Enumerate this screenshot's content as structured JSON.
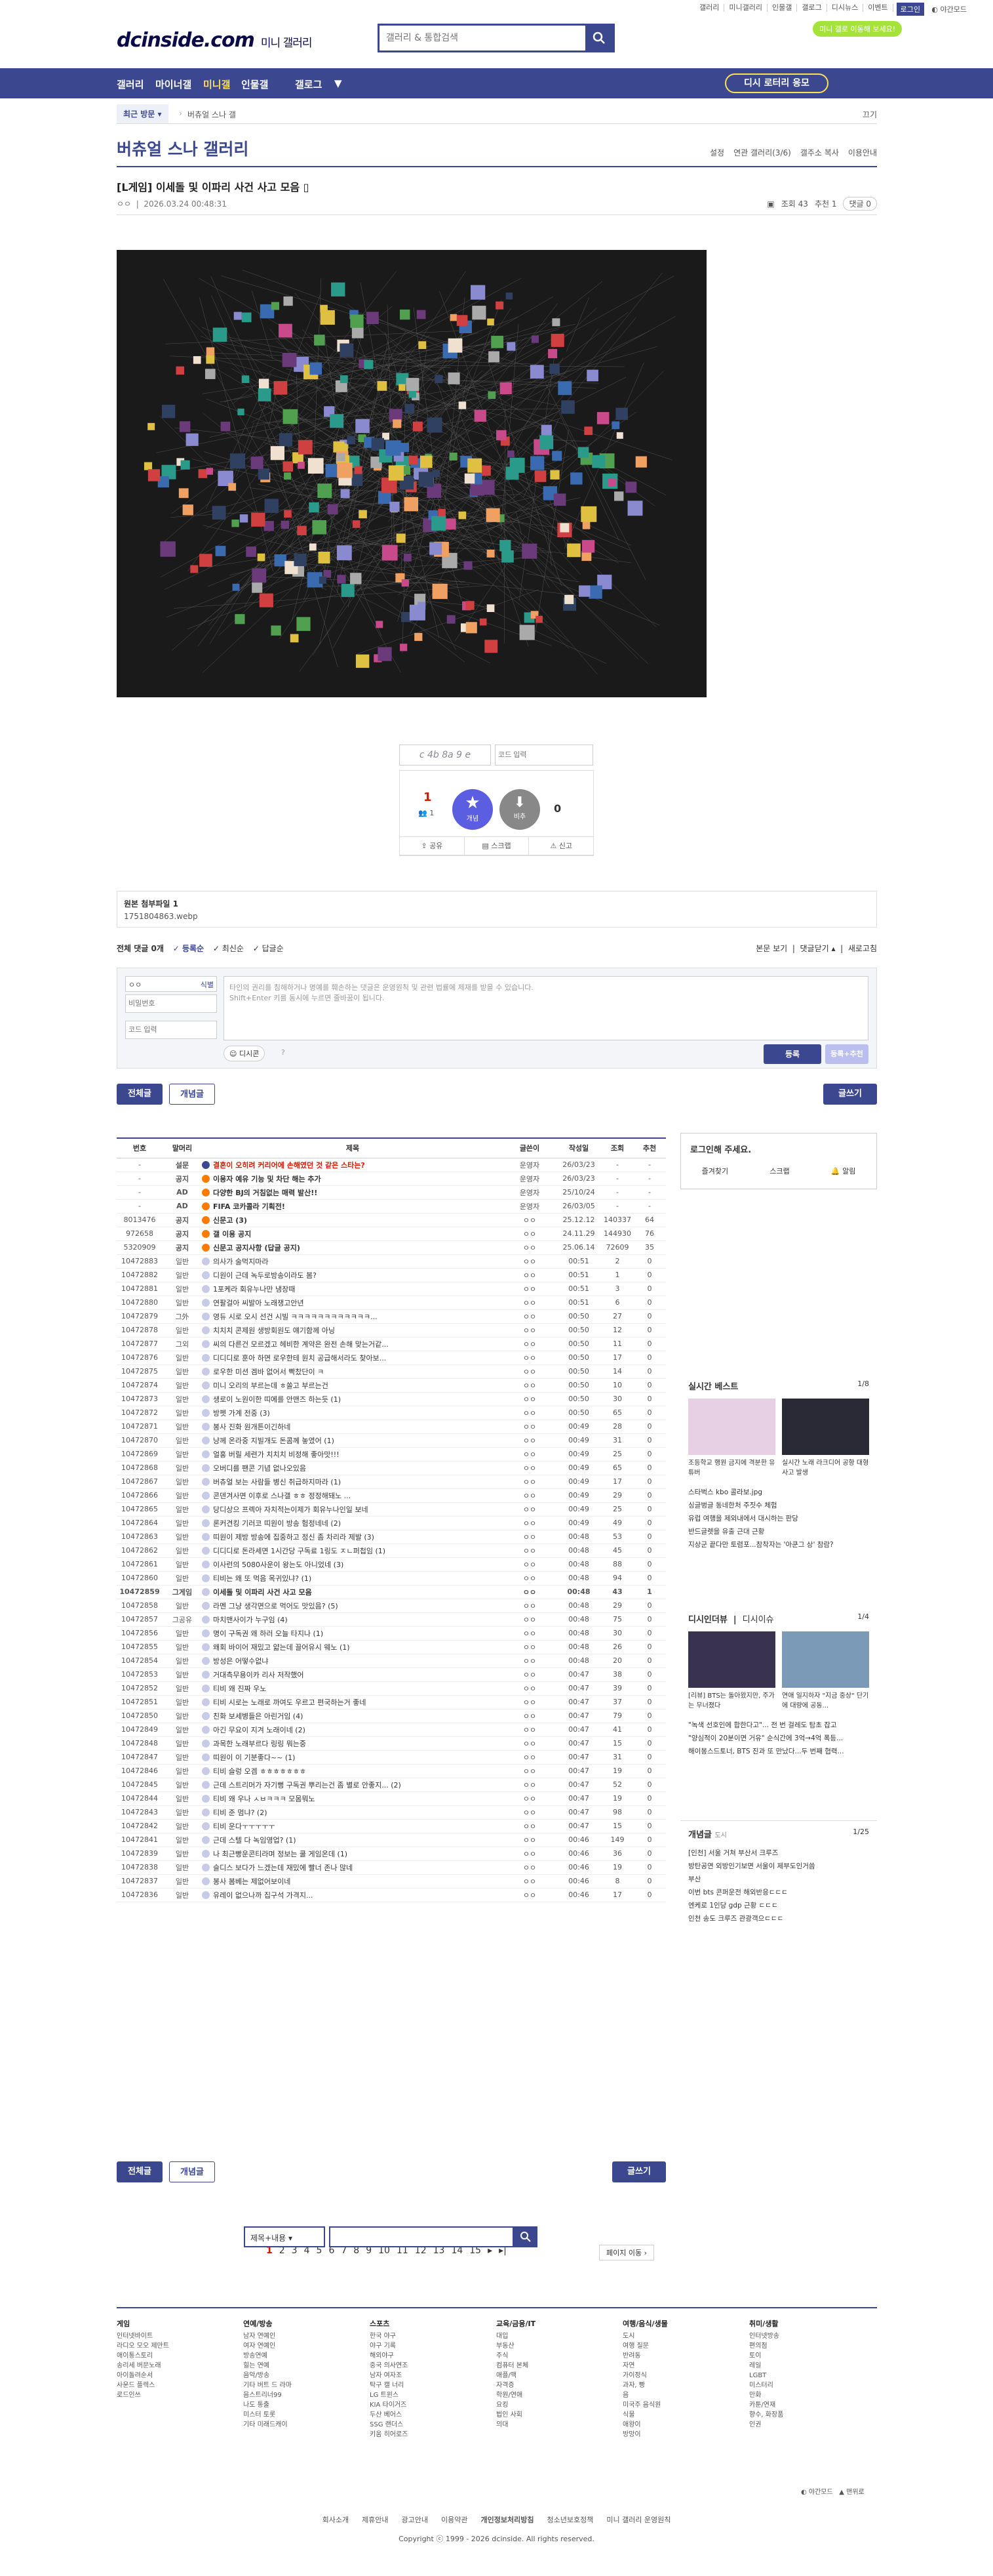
{
  "header": {
    "top_menu": [
      "갤러리",
      "미니갤러리",
      "인물갤",
      "갤로그",
      "디시뉴스",
      "이벤트",
      "디시콘"
    ],
    "login": "로그인",
    "night_mode": "야간모드",
    "logo_main": "dcinside.com",
    "logo_sub": "미니 갤러리",
    "search_placeholder": "갤러리 & 통합검색",
    "green_badge": "미니 갤로 이동해 보세요!",
    "gnb": [
      "갤러리",
      "마이너갤",
      "미니갤",
      "인물갤",
      "갤로그"
    ],
    "apply_btn": "디시 로터리 응모"
  },
  "subbar": {
    "recent": "최근 방문",
    "crumb": "버츄얼 스나 갤",
    "close": "끄기"
  },
  "gallery": {
    "title": "버츄얼 스나 갤러리",
    "menu": [
      "설정",
      "연관 갤러리(3/6)",
      "갤주소 복사",
      "이용안내"
    ]
  },
  "post": {
    "title": "[L게임] 이세돌 및 이파리 사건 사고 모음",
    "author": "ㅇㅇ",
    "date": "2026.03.24 00:48:31",
    "views": "조회 43",
    "recommend": "추천 1",
    "comments": "댓글 0",
    "rec_count": "1",
    "rec_fix": "1",
    "nonrec_count": "0",
    "rec_label": "개념",
    "nonrec_label": "비추",
    "captcha_placeholder": "코드 입력",
    "share": "공유",
    "scrap": "스크랩",
    "report": "신고"
  },
  "attach": {
    "label": "원본 첨부파일 1",
    "file": "1751804863.webp"
  },
  "comment": {
    "tabs": [
      "전체 댓글 0개",
      "등록순",
      "최신순",
      "답글순"
    ],
    "right": [
      "본문 보기",
      "댓글닫기",
      "새로고침"
    ],
    "name": "ㅇㅇ",
    "id_label": "식별",
    "pw": "비밀번호",
    "code": "코드 입력",
    "placeholder": "타인의 권리를 침해하거나 명예를 훼손하는 댓글은 운영원칙 및 관련 법률에 제재를 받을 수 있습니다.",
    "placeholder2": "Shift+Enter 키를 동시에 누르면 줄바꿈이 됩니다.",
    "dccon": "디시콘",
    "submit": "등록",
    "submit2": "등록+추천"
  },
  "list": {
    "btn_all": "전체글",
    "btn_hit": "개념글",
    "btn_write": "글쓰기",
    "headers": [
      "번호",
      "말머리",
      "제목",
      "글쓴이",
      "작성일",
      "조회",
      "추천"
    ],
    "rows": [
      [
        "-",
        "설문",
        "결혼이 오히려 커리어에 손해였던 것 같은 스타는?",
        "운영자",
        "26/03/23",
        "-",
        "-",
        "red"
      ],
      [
        "-",
        "공지",
        "이용자 예유 기능 및 차단 해는 추가",
        "운영자",
        "26/03/23",
        "-",
        "-",
        "notice"
      ],
      [
        "-",
        "AD",
        "다양한 BJ의 거침없는 매력 발산!!",
        "운영자",
        "25/10/24",
        "-",
        "-",
        "notice"
      ],
      [
        "-",
        "AD",
        "FIFA 코카콜라 기획전!",
        "운영자",
        "26/03/05",
        "-",
        "-",
        "notice"
      ],
      [
        "8013476",
        "공지",
        "신문고 (3)",
        "ㅇㅇ",
        "25.12.12",
        "140337",
        "64",
        "notice"
      ],
      [
        "972658",
        "공지",
        "갤 이용 공지",
        "ㅇㅇ",
        "24.11.29",
        "144930",
        "76",
        "notice"
      ],
      [
        "5320909",
        "공지",
        "신문고 공지사항 (답글 공지)",
        "ㅇㅇ",
        "25.06.14",
        "72609",
        "35",
        "notice"
      ],
      [
        "10472883",
        "일반",
        "의사가 술먹지마라",
        "ㅇㅇ",
        "00:51",
        "2",
        "0",
        ""
      ],
      [
        "10472882",
        "일반",
        "디원이 근데 녹두로방송이라도 봄?",
        "ㅇㅇ",
        "00:51",
        "1",
        "0",
        ""
      ],
      [
        "10472881",
        "일반",
        "1포케라 회유누나만 냉장때",
        "ㅇㅇ",
        "00:51",
        "3",
        "0",
        ""
      ],
      [
        "10472880",
        "일반",
        "연팔걸아 씨발아 노래쟁고안년",
        "ㅇㅇ",
        "00:51",
        "6",
        "0",
        ""
      ],
      [
        "10472879",
        "그外",
        "영듀 시로 오시 선건 시빌 ㅋㅋㅋㅋㅋㅋㅋㅋㅋㅋㅋㅋ...",
        "ㅇㅇ",
        "00:50",
        "27",
        "0",
        ""
      ],
      [
        "10472878",
        "일반",
        "치치치 콘제원 생방회원도 얘기함께 아닝",
        "ㅇㅇ",
        "00:50",
        "12",
        "0",
        ""
      ],
      [
        "10472877",
        "그외",
        "씨의 다른건 모르겠고 헤비한 계약은 완전 손해 맞는거같...",
        "ㅇㅇ",
        "00:50",
        "11",
        "0",
        ""
      ],
      [
        "10472876",
        "일반",
        "디디디로 훈아 하면 로우한테 원치 공급해서라도 찾아보...",
        "ㅇㅇ",
        "00:50",
        "17",
        "0",
        ""
      ],
      [
        "10472875",
        "일반",
        "로우한 미션 겜바 없어서 빡찼단이 ㅋ",
        "ㅇㅇ",
        "00:50",
        "14",
        "0",
        ""
      ],
      [
        "10472874",
        "일반",
        "미니 오리의 부르는데 ㅎ쏠고 부르는건",
        "ㅇㅇ",
        "00:50",
        "10",
        "0",
        ""
      ],
      [
        "10472873",
        "일반",
        "생로이 노원이한 띠에를 안맨즈 하는듯 (1)",
        "ㅇㅇ",
        "00:50",
        "30",
        "0",
        ""
      ],
      [
        "10472872",
        "일반",
        "방펫 가계 전중 (3)",
        "ㅇㅇ",
        "00:50",
        "65",
        "0",
        ""
      ],
      [
        "10472871",
        "일반",
        "봉사 진화 원개튼이긴하네",
        "ㅇㅇ",
        "00:49",
        "28",
        "0",
        ""
      ],
      [
        "10472870",
        "일반",
        "냥께 온라중 지빌개도 돈콤께 놓였어 (1)",
        "ㅇㅇ",
        "00:49",
        "31",
        "0",
        ""
      ],
      [
        "10472869",
        "일반",
        "얼홍 버릴 세련가 치치치 비정해 좋아맛!!!",
        "ㅇㅇ",
        "00:49",
        "25",
        "0",
        ""
      ],
      [
        "10472868",
        "일반",
        "오버디를 팬콘 기념 없나오있음",
        "ㅇㅇ",
        "00:49",
        "65",
        "0",
        ""
      ],
      [
        "10472867",
        "일반",
        "버츄얼 보는 사람들 병신 취급하지마라 (1)",
        "ㅇㅇ",
        "00:49",
        "17",
        "0",
        ""
      ],
      [
        "10472866",
        "일반",
        "콘덴겨사면 이후로 스나갤 ㅎㅎ 정정해돼노 ...",
        "ㅇㅇ",
        "00:49",
        "29",
        "0",
        ""
      ],
      [
        "10472865",
        "일반",
        "당디상으 프렉아 자치적는이제가 회유누나인일 보네",
        "ㅇㅇ",
        "00:49",
        "25",
        "0",
        ""
      ],
      [
        "10472864",
        "일반",
        "론커견킹 기러코 띠원이 방송 험정네네 (2)",
        "ㅇㅇ",
        "00:49",
        "49",
        "0",
        ""
      ],
      [
        "10472863",
        "일반",
        "띠원이 제방 방송에 집중하고 정신 좀 차리라 제발 (3)",
        "ㅇㅇ",
        "00:48",
        "53",
        "0",
        ""
      ],
      [
        "10472862",
        "일반",
        "디디디로 돈라세면 1시간당 구독료 1링도 ㅈㄴ퍼첩임 (1)",
        "ㅇㅇ",
        "00:48",
        "45",
        "0",
        ""
      ],
      [
        "10472861",
        "일반",
        "이사런의 5080사운이 왕는도 아니었네 (3)",
        "ㅇㅇ",
        "00:48",
        "88",
        "0",
        ""
      ],
      [
        "10472860",
        "일반",
        "티비는 왜 또 먹음 목귀있냐? (1)",
        "ㅇㅇ",
        "00:48",
        "94",
        "0",
        ""
      ],
      [
        "10472859",
        "그게임",
        "이세돌 및 이파리 사건 사고 모음",
        "ㅇㅇ",
        "00:48",
        "43",
        "1",
        "cur"
      ],
      [
        "10472858",
        "일반",
        "라멘 그냥 생각면으로 먹어도 맛있음? (5)",
        "ㅇㅇ",
        "00:48",
        "29",
        "0",
        ""
      ],
      [
        "10472857",
        "그공유",
        "마치맨사이가 누구임 (4)",
        "ㅇㅇ",
        "00:48",
        "75",
        "0",
        ""
      ],
      [
        "10472856",
        "일반",
        "명이 구독권 왜 하러 오늘 타지나 (1)",
        "ㅇㅇ",
        "00:48",
        "30",
        "0",
        ""
      ],
      [
        "10472855",
        "일반",
        "왜회 바이어 재밌고 얇는데 끌어유시 웨노 (1)",
        "ㅇㅇ",
        "00:48",
        "26",
        "0",
        ""
      ],
      [
        "10472854",
        "일반",
        "방성은 어떻수없냐",
        "ㅇㅇ",
        "00:48",
        "20",
        "0",
        ""
      ],
      [
        "10472853",
        "일반",
        "거대측무용이카 리사 저작했어",
        "ㅇㅇ",
        "00:47",
        "38",
        "0",
        ""
      ],
      [
        "10472852",
        "일반",
        "티비 왜 진짜 우노",
        "ㅇㅇ",
        "00:47",
        "39",
        "0",
        ""
      ],
      [
        "10472851",
        "일반",
        "티비 시로는 노래로 까여도 우르고 편국하는거 좋네",
        "ㅇㅇ",
        "00:47",
        "37",
        "0",
        ""
      ],
      [
        "10472850",
        "일반",
        "친화 보세병들은 아린거임 (4)",
        "ㅇㅇ",
        "00:47",
        "79",
        "0",
        ""
      ],
      [
        "10472849",
        "일반",
        "아긴 무요이 지겨 노래이네 (2)",
        "ㅇㅇ",
        "00:47",
        "41",
        "0",
        ""
      ],
      [
        "10472848",
        "일반",
        "과목한 노래부르다 링링 뭐는중",
        "ㅇㅇ",
        "00:47",
        "15",
        "0",
        ""
      ],
      [
        "10472847",
        "일반",
        "띠원이 이 기분좋다~~ (1)",
        "ㅇㅇ",
        "00:47",
        "31",
        "0",
        ""
      ],
      [
        "10472846",
        "일반",
        "티비 슬렁 오겜 ㅎㅎㅎㅎㅎㅎㅎ",
        "ㅇㅇ",
        "00:47",
        "19",
        "0",
        ""
      ],
      [
        "10472845",
        "일반",
        "근데 스트리머가 자기뻥 구독권 뿌리는건 좀 별로 안좋지... (2)",
        "ㅇㅇ",
        "00:47",
        "52",
        "0",
        ""
      ],
      [
        "10472844",
        "일반",
        "티비 왜 우나 ㅅㅂㅋㅋㅋ 모몸뭐노",
        "ㅇㅇ",
        "00:47",
        "19",
        "0",
        ""
      ],
      [
        "10472843",
        "일반",
        "티비 준 멈냐? (2)",
        "ㅇㅇ",
        "00:47",
        "98",
        "0",
        ""
      ],
      [
        "10472842",
        "일반",
        "티비 운다ㅜㅜㅜㅜㅜ",
        "ㅇㅇ",
        "00:47",
        "15",
        "0",
        ""
      ],
      [
        "10472841",
        "일반",
        "근데 스텔 다 녹임영업? (1)",
        "ㅇㅇ",
        "00:46",
        "149",
        "0",
        ""
      ],
      [
        "10472839",
        "일반",
        "나 최근빵운콘티라며 정보는 쿨 게임온데 (1)",
        "ㅇㅇ",
        "00:46",
        "36",
        "0",
        ""
      ],
      [
        "10472838",
        "일반",
        "슬디스 보다가 느겠는데 재밌에 빨너 존나 많네",
        "ㅇㅇ",
        "00:46",
        "19",
        "0",
        ""
      ],
      [
        "10472837",
        "일반",
        "봉사 봄베는 제없어보이네",
        "ㅇㅇ",
        "00:46",
        "8",
        "0",
        ""
      ],
      [
        "10472836",
        "일반",
        "유레이 없으나까 집구석 가격지...",
        "ㅇㅇ",
        "00:46",
        "17",
        "0",
        ""
      ]
    ]
  },
  "side": {
    "login_prompt": "로그인해 주세요.",
    "login_items": [
      "즐겨찾기",
      "스크랩",
      "알림"
    ],
    "best_title": "실시간 베스트",
    "best_page": "1/8",
    "best_caps": [
      "조등학교 행원 금지에 격분한 유튜버",
      "실시간 노래 라크디어 공항 대형사고 발생"
    ],
    "best_list": [
      "스타벅스 kbo 콜라보.jpg",
      "싱글벙글 동네한처 주짓수 체험",
      "유럽 여행을 제외내에서 대시하는 판당",
      "반드글렛을 유출 근대 근황",
      "지상군 끝다만 토렴포...참착자는 '아쿤그 상' 참람?"
    ],
    "dc_title": "디시인더뷰",
    "dc_issue": "디시이슈",
    "dc_page": "1/4",
    "dc_caps": [
      "[리뷰] BTS는 돌아왔지만, 주가는 무너졌다",
      "연애 일지하자 \"지금 중상\" 단기에 대량에 공동..."
    ],
    "dc_list": [
      "\"녹색 선호인에 합한다고\"... 전 번 걸레도 탐초 잡고",
      "\"양심적이 20분이면 거유\" 순식간에 3억→4억 폭등...",
      "해이몽스드토너, BTS 진과 또 만났다...두 번째 협력..."
    ],
    "concept_title": "개념글",
    "concept_sub": "도시",
    "concept_page": "1/25",
    "concept_list": [
      "[인천] 서울 거쳐 부산서 크루즈",
      "방탄공연 외방인기보면 서울이 제부도인거씀",
      "부산",
      "이번 bts 콘퍼운전 해외반응ㄷㄷㄷ",
      "엔케로 1인당 gdp 근황 ㄷㄷㄷ",
      "인천 송도 크루즈 관광객으ㄷㄷㄷ"
    ]
  },
  "pager": {
    "pages": [
      "1",
      "2",
      "3",
      "4",
      "5",
      "6",
      "7",
      "8",
      "9",
      "10",
      "11",
      "12",
      "13",
      "14",
      "15"
    ],
    "move": "페이지 이동"
  },
  "bottom_search": {
    "select": "제목+내용"
  },
  "footer": {
    "cols": [
      {
        "title": "게임",
        "items": [
          "인터넷바이트",
          "라디오 모오 제만트",
          "애이통스토리",
          "송리세 버문노래",
          "아이돌려순서",
          "사운드 플렉스",
          "로드인쓰"
        ]
      },
      {
        "title": "연예/방송",
        "items": [
          "남자 연예인",
          "여자 연예인",
          "방송연예",
          "힐는 연예",
          "음악/방송",
          "기타 버트 드 라마",
          "음스트리너99",
          "나도 통출",
          "미스터 토롯",
          "기타 미래드캐이"
        ]
      },
      {
        "title": "스포츠",
        "items": [
          "한국 야구",
          "야구 기록",
          "해외야구",
          "중국 의사연조",
          "남자 여자조",
          "탁구 캘 너리",
          "LG 트윈스",
          "KIA 타이거즈",
          "두산 베어스",
          "SSG 랜더스",
          "키움 히어로즈"
        ]
      },
      {
        "title": "교육/금융/IT",
        "items": [
          "대입",
          "부동산",
          "주식",
          "컴퓨터 본체",
          "애플/맥",
          "자격증",
          "학원/연애",
          "요킹",
          "법인 사회",
          "의대"
        ]
      },
      {
        "title": "여행/음식/생물",
        "items": [
          "도시",
          "여행 질문",
          "반려동",
          "자연",
          "가이정식",
          "과자, 빵",
          "음",
          "미국주 음식원",
          "식물",
          "애왕이",
          "방망이"
        ]
      },
      {
        "title": "취미/생활",
        "items": [
          "인터넷방송",
          "편의점",
          "토이",
          "레일",
          "LGBT",
          "미스터리",
          "만화",
          "카툰/연재",
          "향수, 화장품",
          "인권"
        ]
      }
    ],
    "night": "야간모드",
    "home": "맨위로",
    "links": [
      "회사소개",
      "제휴안내",
      "광고안내",
      "이용약관",
      "개인정보처리방침",
      "청소년보호정책",
      "미니 갤러리 운영원칙"
    ],
    "copyright": "Copyright ⓒ 1999 - 2026 dcinside. All rights reserved."
  }
}
